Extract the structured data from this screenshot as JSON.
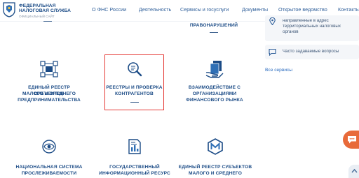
{
  "logo": {
    "line1": "ФЕДЕРАЛЬНАЯ",
    "line2": "НАЛОГОВАЯ СЛУЖБА",
    "sub": "ОФИЦИАЛЬНЫЙ САЙТ"
  },
  "nav": [
    {
      "label": "О ФНС России"
    },
    {
      "label": "Деятельность"
    },
    {
      "label": "Сервисы и госуслуги"
    },
    {
      "label": "Документы"
    },
    {
      "label": "Открытое ведомство"
    },
    {
      "label": "Контакты"
    }
  ],
  "tiles": {
    "top_partial": {
      "title": "ПРАВОНАРУШЕНИЙ"
    },
    "row1": [
      {
        "line1": "ЕДИНЫЙ РЕЕСТР СУБЪЕКТОВ",
        "line2": "МАЛОГО И СРЕДНЕГО",
        "line3": "ПРЕДПРИНИМАТЕЛЬСТВА"
      },
      {
        "line1": "РЕЕСТРЫ И ПРОВЕРКА",
        "line2": "КОНТРАГЕНТОВ"
      },
      {
        "line1": "ВЗАИМОДЕЙСТВИЕ С",
        "line2": "ОРГАНИЗАЦИЯМИ",
        "line3": "ФИНАНСОВОГО РЫНКА"
      }
    ],
    "row2": [
      {
        "line1": "НАЦИОНАЛЬНАЯ СИСТЕМА",
        "line2": "ПРОСЛЕЖИВАЕМОСТИ"
      },
      {
        "line1": "ГОСУДАРСТВЕННЫЙ",
        "line2": "ИНФОРМАЦИОННЫЙ РЕСУРС"
      },
      {
        "line1": "ЕДИНЫЙ РЕЕСТР СУБЪЕКТОВ",
        "line2": "МАЛОГО И СРЕДНЕГО"
      }
    ]
  },
  "panel": {
    "card1": {
      "line1": "направленные в адрес",
      "line2": "территориальных налоговых",
      "line3": "органов"
    },
    "card2": {
      "text": "Часто задаваемые вопросы"
    },
    "all_services": "Все сервисы"
  },
  "colors": {
    "brand": "#1b4b86",
    "accent": "#e86a3a",
    "selected_border": "#e53935"
  }
}
